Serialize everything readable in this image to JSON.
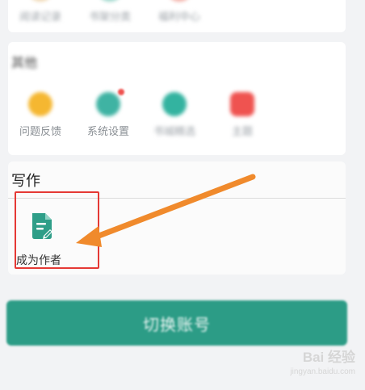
{
  "top_row": {
    "items": [
      {
        "label": "阅读记录",
        "color": "#f0d9b5"
      },
      {
        "label": "书架分类",
        "color": "#9fd8cc"
      },
      {
        "label": "福利中心",
        "color": "#f3b1a8"
      }
    ]
  },
  "misc_section": {
    "title": "其他",
    "items": [
      {
        "label": "问题反馈",
        "color": "#f5b731",
        "icon": "question-icon"
      },
      {
        "label": "系统设置",
        "color": "#3fb3a3",
        "icon": "gear-icon"
      },
      {
        "label": "书城精选",
        "color": "#33b3a0",
        "icon": "book-icon"
      },
      {
        "label": "主题",
        "color": "#ef5350",
        "icon": "shirt-icon"
      }
    ]
  },
  "write_section": {
    "title": "写作",
    "become_author_label": "成为作者",
    "icon": "document-edit-icon",
    "icon_color": "#2e9e88",
    "highlight_color": "#e53935"
  },
  "switch_account_label": "切换账号",
  "annotation": {
    "arrow_color": "#f08a2c"
  },
  "watermark": {
    "main": "Bai 经验",
    "sub": "jingyan.baidu.com"
  }
}
